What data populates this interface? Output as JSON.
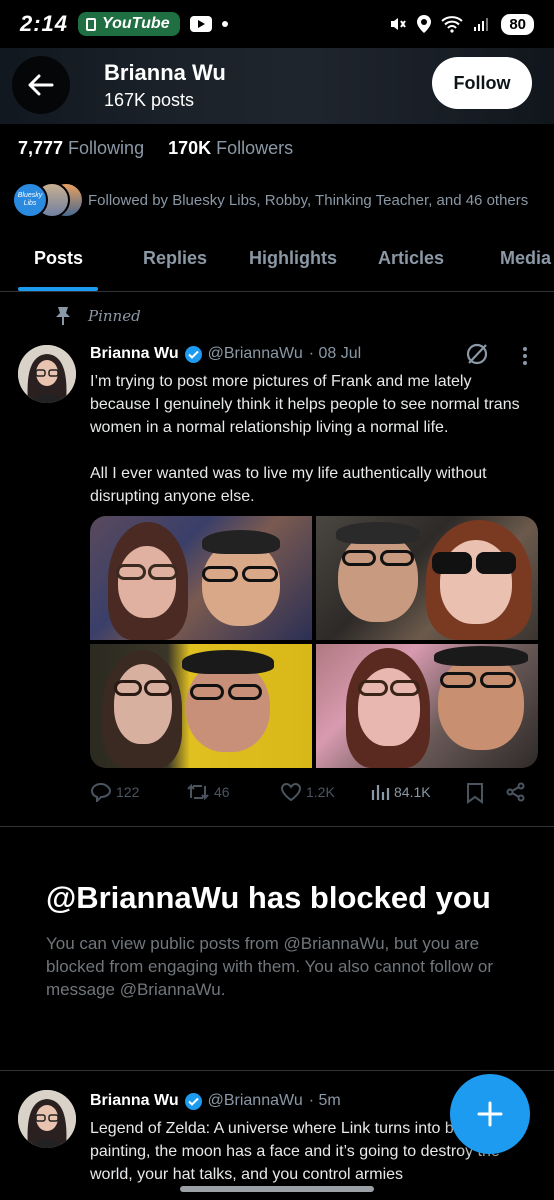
{
  "status_bar": {
    "time": "2:14",
    "notification_app": "YouTube",
    "battery": "80"
  },
  "header": {
    "name": "Brianna Wu",
    "posts_count": "167K posts",
    "follow_label": "Follow"
  },
  "stats": {
    "following_count": "7,777",
    "following_label": "Following",
    "followers_count": "170K",
    "followers_label": "Followers"
  },
  "followed_by": {
    "text": "Followed by Bluesky Libs, Robby, Thinking Teacher, and 46 others",
    "avatar_label": "Bluesky Libs"
  },
  "tabs": [
    {
      "label": "Posts"
    },
    {
      "label": "Replies"
    },
    {
      "label": "Highlights"
    },
    {
      "label": "Articles"
    },
    {
      "label": "Media"
    }
  ],
  "pinned_tweet": {
    "pinned_label": "Pinned",
    "author": "Brianna Wu",
    "handle": "@BriannaWu",
    "date": "· 08 Jul",
    "text": "I’m trying to post more pictures of Frank and me lately because I genuinely think it helps people to see normal trans women in a normal relationship living a normal life.\n\nAll I ever wanted was to live my life authentically without disrupting anyone else.",
    "replies": "122",
    "reposts": "46",
    "likes": "1.2K",
    "views": "84.1K"
  },
  "blocked": {
    "title": "@BriannaWu has blocked you",
    "body": "You can view public posts from @BriannaWu, but you are blocked from engaging with them. You also cannot follow or message @BriannaWu."
  },
  "second_tweet": {
    "author": "Brianna Wu",
    "handle": "@BriannaWu",
    "date": "· 5m",
    "text": "Legend of Zelda: A universe where Link turns into becomes a painting, the moon has a face and it’s going to destroy the world, your hat talks, and you control armies"
  },
  "colors": {
    "accent": "#1d9bf0",
    "background": "#000000",
    "secondary_text": "#8b98a5"
  }
}
